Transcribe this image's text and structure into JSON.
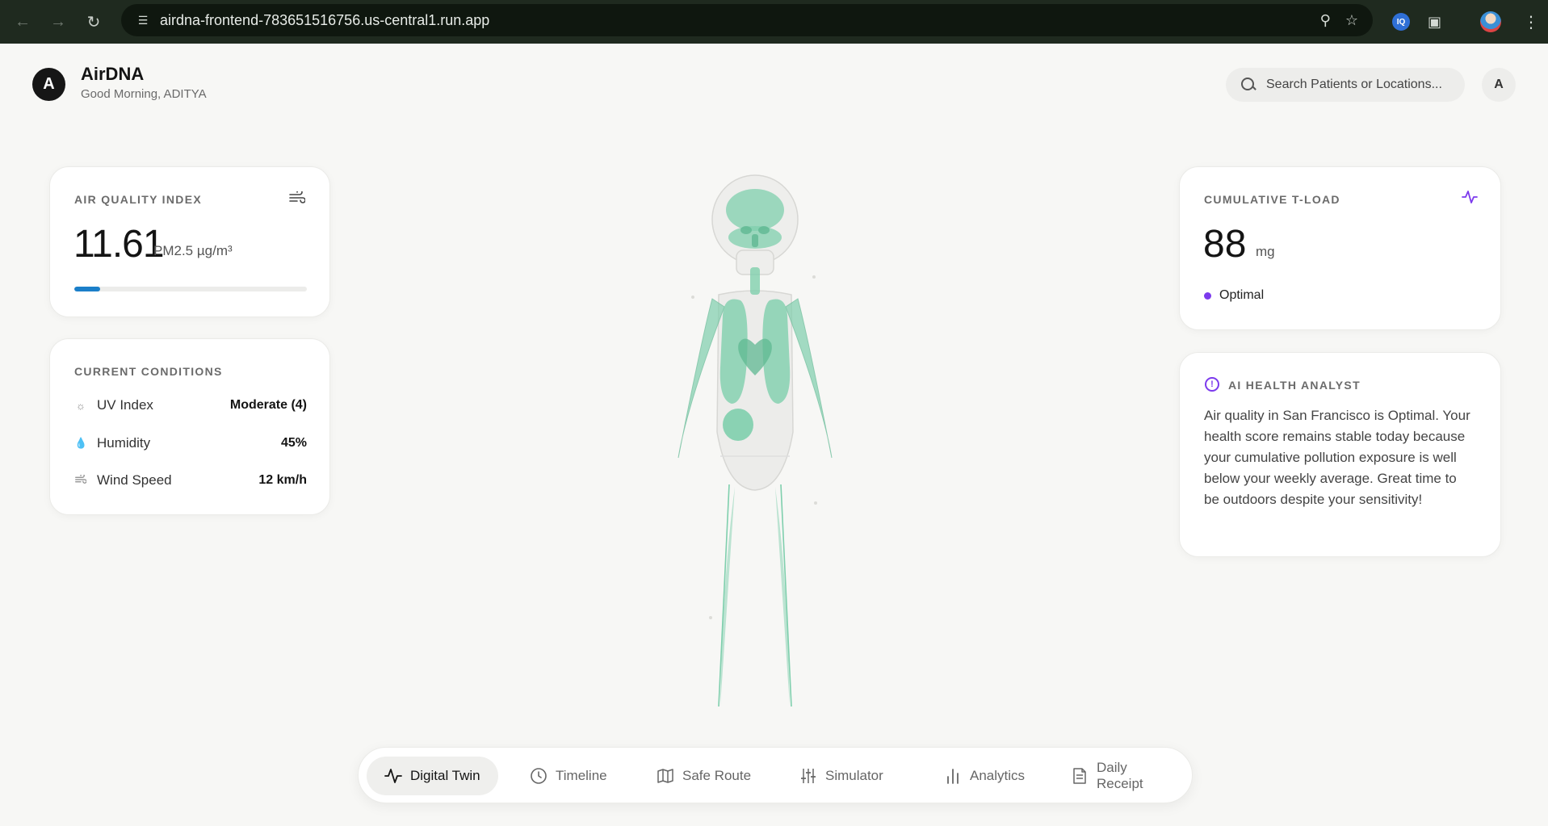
{
  "browser": {
    "url": "airdna-frontend-783651516756.us-central1.run.app",
    "nav": [
      "back-icon",
      "forward-icon",
      "reload-icon"
    ]
  },
  "app": {
    "logo_letter": "A",
    "title": "AirDNA",
    "greeting": "Good Morning, ADITYA",
    "search_placeholder": "Search Patients or Locations...",
    "avatar_letter": "A"
  },
  "aqi": {
    "label": "AIR QUALITY INDEX",
    "value": "11.61",
    "unit": "PM2.5 µg/m³",
    "level_fraction": 0.11,
    "bar_color": "#1b7fc9"
  },
  "conditions": {
    "label": "CURRENT CONDITIONS",
    "rows": [
      {
        "icon": "sun-icon",
        "label": "UV Index",
        "value": "Moderate (4)"
      },
      {
        "icon": "droplet-icon",
        "label": "Humidity",
        "value": "45%"
      },
      {
        "icon": "wind-icon",
        "label": "Wind Speed",
        "value": "12 km/h"
      }
    ]
  },
  "tload": {
    "label": "CUMULATIVE T-LOAD",
    "value": "88",
    "unit": "mg",
    "status": "Optimal",
    "status_color": "#7c3aed"
  },
  "ai": {
    "label": "AI HEALTH ANALYST",
    "text": "Air quality in San Francisco is Optimal. Your health score remains stable today because your cumulative pollution exposure is well below your weekly average. Great time to be outdoors despite your sensitivity!"
  },
  "nav": {
    "items": [
      {
        "label": "Digital Twin",
        "icon": "pulse-icon",
        "active": true
      },
      {
        "label": "Timeline",
        "icon": "clock-icon",
        "active": false
      },
      {
        "label": "Safe Route",
        "icon": "map-icon",
        "active": false
      },
      {
        "label": "Simulator",
        "icon": "sliders-icon",
        "active": false
      },
      {
        "label": "Analytics",
        "icon": "bar-chart-icon",
        "active": false
      },
      {
        "label": "Daily Receipt",
        "icon": "receipt-icon",
        "active": false
      }
    ]
  },
  "colors": {
    "organ": "#7fcfad",
    "accent": "#7c3aed"
  }
}
